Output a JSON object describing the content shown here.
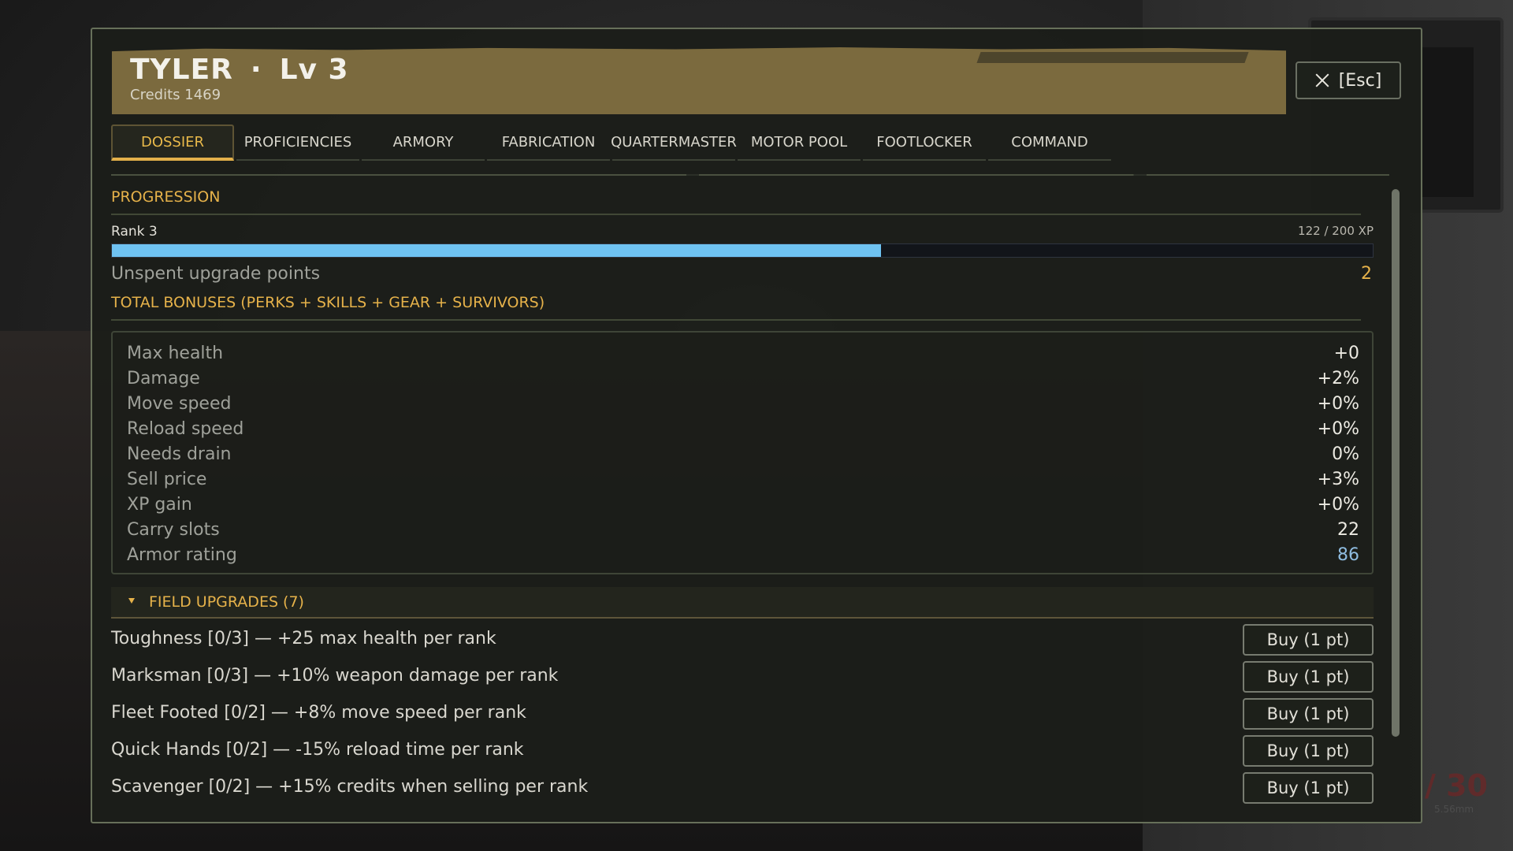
{
  "header": {
    "name": "TYLER",
    "separator": "·",
    "level": "Lv 3",
    "credits_label": "Credits",
    "credits_value": "1469",
    "close_label": "[Esc]"
  },
  "tabs": [
    {
      "label": "DOSSIER",
      "active": true
    },
    {
      "label": "PROFICIENCIES"
    },
    {
      "label": "ARMORY"
    },
    {
      "label": "FABRICATION"
    },
    {
      "label": "QUARTERMASTER"
    },
    {
      "label": "MOTOR POOL"
    },
    {
      "label": "FOOTLOCKER"
    },
    {
      "label": "COMMAND"
    }
  ],
  "progression": {
    "title": "PROGRESSION",
    "rank_label": "Rank 3",
    "xp_text": "122 / 200 XP",
    "xp_fraction": 0.61,
    "unspent_label": "Unspent upgrade points",
    "unspent_value": "2"
  },
  "bonuses": {
    "title": "TOTAL BONUSES  (PERKS + SKILLS + GEAR + SURVIVORS)",
    "rows": [
      {
        "name": "Max health",
        "value": "+0"
      },
      {
        "name": "Damage",
        "value": "+2%"
      },
      {
        "name": "Move speed",
        "value": "+0%"
      },
      {
        "name": "Reload speed",
        "value": "+0%"
      },
      {
        "name": "Needs drain",
        "value": "0%"
      },
      {
        "name": "Sell price",
        "value": "+3%"
      },
      {
        "name": "XP gain",
        "value": "+0%"
      },
      {
        "name": "Carry slots",
        "value": "22"
      },
      {
        "name": "Armor rating",
        "value": "86"
      }
    ]
  },
  "field_upgrades": {
    "title": "FIELD UPGRADES   (7)",
    "items": [
      {
        "text": "Toughness  [0/3]  — +25 max health per rank",
        "button": "Buy (1 pt)"
      },
      {
        "text": "Marksman  [0/3]  — +10% weapon damage per rank",
        "button": "Buy (1 pt)"
      },
      {
        "text": "Fleet Footed  [0/2]  — +8% move speed per rank",
        "button": "Buy (1 pt)"
      },
      {
        "text": "Quick Hands  [0/2]  — -15% reload time per rank",
        "button": "Buy (1 pt)"
      },
      {
        "text": "Scavenger  [0/2]  — +15% credits when selling per rank",
        "button": "Buy (1 pt)"
      }
    ]
  },
  "hud": {
    "ammo": "/ 30",
    "caliber": "5.56mm"
  },
  "colors": {
    "accent": "#e6b24a",
    "xp_fill": "#6fc3f2",
    "banner": "#7b6a3e"
  }
}
